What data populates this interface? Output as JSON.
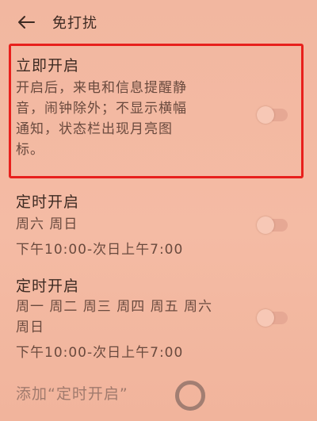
{
  "header": {
    "title": "免打扰",
    "back_icon": "arrow-left-icon"
  },
  "immediate": {
    "title": "立即开启",
    "desc_lines": [
      "开启后，来电和信息提醒静",
      "音，闹钟除外；不显示横幅",
      "通知，状态栏出现月亮图",
      "标。"
    ],
    "toggle_on": false
  },
  "schedule1": {
    "title": "定时开启",
    "days": "周六 周日",
    "time": "下午10:00-次日上午7:00",
    "toggle_on": false
  },
  "schedule2": {
    "title": "定时开启",
    "days_line1": "周一 周二 周三 周四 周五 周六",
    "days_line2": "周日",
    "time": "下午10:00-次日上午7:00",
    "toggle_on": false
  },
  "add_schedule": {
    "label": "添加“定时开启”"
  },
  "colors": {
    "background": "#f3b9a2",
    "highlight_border": "#e8201c"
  }
}
